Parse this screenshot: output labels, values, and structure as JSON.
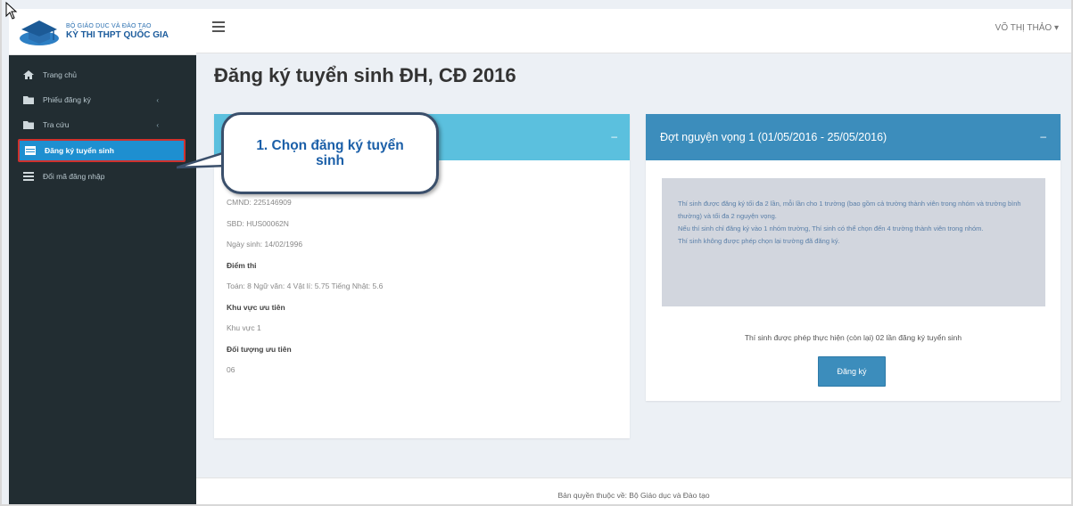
{
  "header": {
    "logo_subtitle": "BỘ GIÁO DỤC VÀ ĐÀO TẠO",
    "logo_title": "KỲ THI THPT QUỐC GIA",
    "user_name": "VÕ THỊ THẢO ▾"
  },
  "sidebar": {
    "items": [
      {
        "label": "Trang chủ",
        "icon": "home-icon",
        "has_submenu": false,
        "active": false
      },
      {
        "label": "Phiếu đăng ký",
        "icon": "folder-icon",
        "has_submenu": true,
        "active": false
      },
      {
        "label": "Tra cứu",
        "icon": "folder-icon",
        "has_submenu": true,
        "active": false
      },
      {
        "label": "Đăng ký tuyển sinh",
        "icon": "table-icon",
        "has_submenu": false,
        "active": true
      },
      {
        "label": "Đổi mã đăng nhập",
        "icon": "list-icon",
        "has_submenu": false,
        "active": false
      }
    ],
    "submenu_glyph": "‹"
  },
  "page": {
    "title": "Đăng ký tuyển sinh ĐH, CĐ 2016"
  },
  "student_panel": {
    "collapse_glyph": "–",
    "rows": [
      {
        "text": "CMND: 225146909",
        "label": false
      },
      {
        "text": "SBD: HUS00062N",
        "label": false
      },
      {
        "text": "Ngày sinh: 14/02/1996",
        "label": false
      },
      {
        "text": "Điểm thi",
        "label": true
      },
      {
        "text": "Toán: 8 Ngữ văn: 4 Vật lí: 5.75 Tiếng Nhật: 5.6",
        "label": false
      },
      {
        "text": "Khu vực ưu tiên",
        "label": true
      },
      {
        "text": "Khu vực 1",
        "label": false
      },
      {
        "text": "Đối tượng ưu tiên",
        "label": true
      },
      {
        "text": "06",
        "label": false
      }
    ]
  },
  "round_panel": {
    "title": "Đợt nguyện vọng 1 (01/05/2016 - 25/05/2016)",
    "collapse_glyph": "–",
    "notice": [
      "Thí sinh được đăng ký tối đa 2 lần, mỗi lần cho 1 trường (bao gồm cả trường thành viên trong nhóm và trường bình thường) và tối đa 2 nguyện vọng.",
      "Nếu thí sinh chỉ đăng ký vào 1 nhóm trường, Thí sinh có thể chọn đến 4 trường thành viên trong nhóm.",
      "Thí sinh không được phép chọn lại trường đã đăng ký."
    ],
    "attempts_text": "Thí sinh được phép thực hiện (còn lại) 02 lần đăng ký tuyển sinh",
    "register_label": "Đăng ký"
  },
  "footer": {
    "text": "Bản quyền thuộc về: Bộ Giáo dục và Đào tạo"
  },
  "callout": {
    "text": "1. Chọn đăng ký tuyển sinh"
  },
  "colors": {
    "sidebar_bg": "#222d32",
    "active_item": "#1e8fd0",
    "panel_info_header": "#5bc0de",
    "panel_primary_header": "#3c8dbc",
    "callout_border": "#3a4f6b",
    "callout_text": "#1b5fa8",
    "highlight_border": "#d0312d"
  }
}
